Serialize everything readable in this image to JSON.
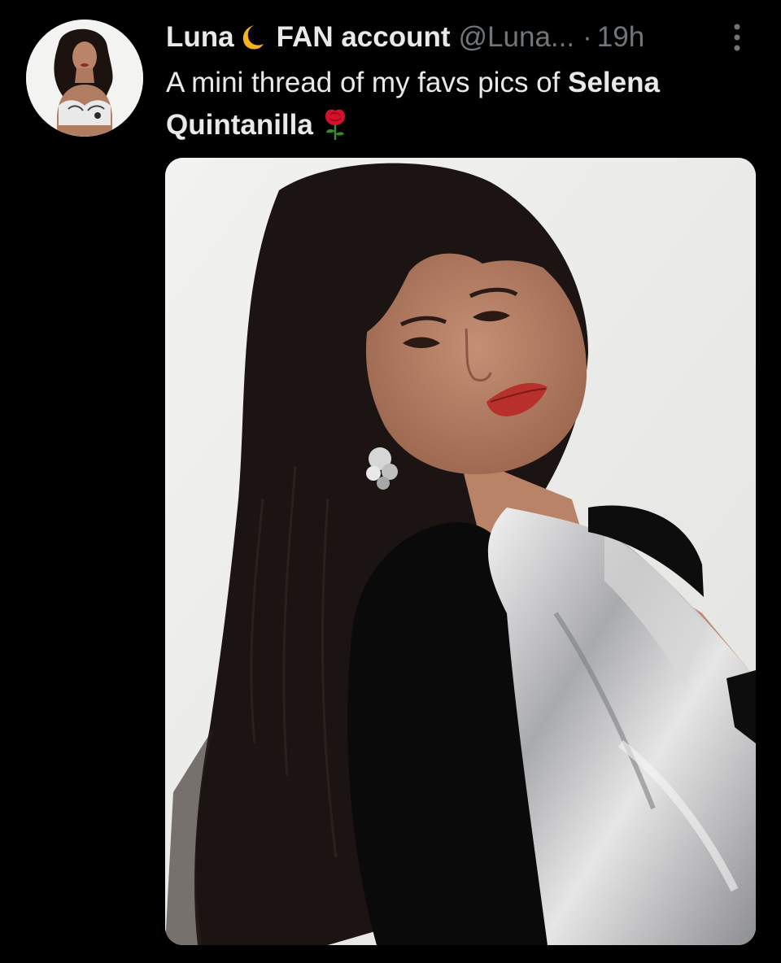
{
  "post": {
    "display_name_part1": "Luna",
    "display_name_emoji": "moon-emoji",
    "display_name_part2": "FAN account",
    "handle": "@Luna...",
    "separator": "·",
    "time": "19h",
    "text_plain": "A mini thread of my favs pics of ",
    "text_bold": "Selena Quintanilla",
    "text_emoji": "rose-emoji"
  },
  "icons": {
    "more": "vertical-dots-icon",
    "moon": "crescent-moon-emoji",
    "rose": "red-rose-emoji"
  },
  "media": {
    "kind": "photo"
  },
  "colors": {
    "background": "#000000",
    "primary_text": "#e7e9ea",
    "secondary_text": "#71767b",
    "moon": "#f6b31f",
    "rose": "#d4102a"
  }
}
